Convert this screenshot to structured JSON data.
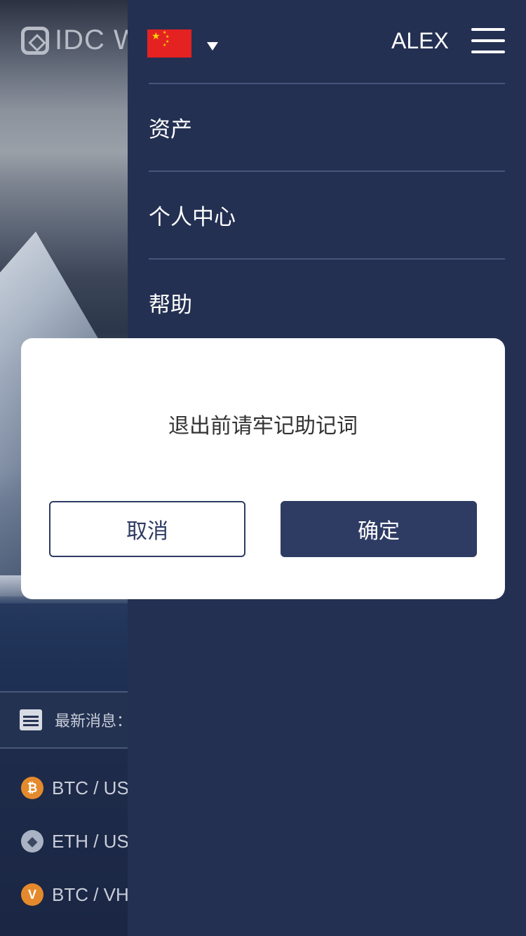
{
  "background": {
    "logo_text": "IDC W",
    "news_label": "最新消息：",
    "tickers": [
      {
        "pair": "BTC / US",
        "icon": "bitcoin-icon"
      },
      {
        "pair": "ETH / US",
        "icon": "ethereum-icon"
      },
      {
        "pair": "BTC / VH",
        "icon": "vhkd-icon"
      }
    ]
  },
  "drawer": {
    "language_flag": "china-flag-icon",
    "username": "ALEX",
    "menu": [
      {
        "label": "资产"
      },
      {
        "label": "个人中心"
      },
      {
        "label": "帮助"
      }
    ]
  },
  "dialog": {
    "message": "退出前请牢记助记词",
    "cancel_label": "取消",
    "confirm_label": "确定"
  },
  "colors": {
    "drawer_bg": "#243052",
    "primary": "#2e3b63",
    "dialog_bg": "#ffffff"
  }
}
